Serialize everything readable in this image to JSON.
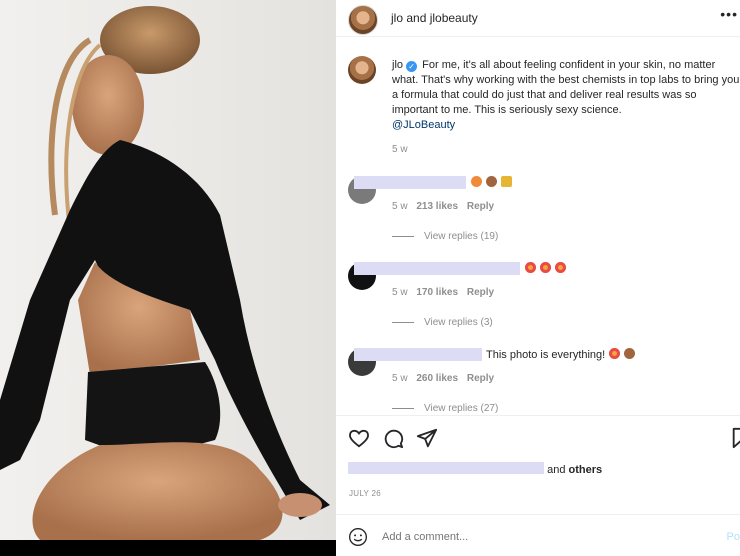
{
  "header": {
    "title": "jlo and jlobeauty"
  },
  "caption": {
    "username": "jlo",
    "text": "For me, it's all about feeling confident in your skin, no matter what. That's why working with the best chemists in top labs to bring you a formula that could do just that and deliver real results was so important to me. This is seriously sexy science.",
    "mention": "@JLoBeauty",
    "time": "5 w"
  },
  "comments": [
    {
      "text": "",
      "emojis": [
        "peach",
        "hand",
        "crown"
      ],
      "time": "5 w",
      "likes": "213 likes",
      "reply_label": "Reply",
      "view_replies": "View replies (19)"
    },
    {
      "text": "",
      "emojis": [
        "heart-eyes",
        "heart-eyes",
        "heart-eyes"
      ],
      "time": "5 w",
      "likes": "170 likes",
      "reply_label": "Reply",
      "view_replies": "View replies (3)"
    },
    {
      "text": "This photo is everything!",
      "emojis": [
        "heart-eyes",
        "hand"
      ],
      "time": "5 w",
      "likes": "260 likes",
      "reply_label": "Reply",
      "view_replies": "View replies (27)"
    }
  ],
  "likes_row": {
    "and": "and",
    "others": "others"
  },
  "date": "JULY 26",
  "add_comment": {
    "placeholder": "Add a comment...",
    "post_label": "Po"
  },
  "colors": {
    "accent": "#3897f0",
    "mention": "#00376b",
    "muted": "#8e8e8e",
    "redaction": "#dcdcf4"
  }
}
